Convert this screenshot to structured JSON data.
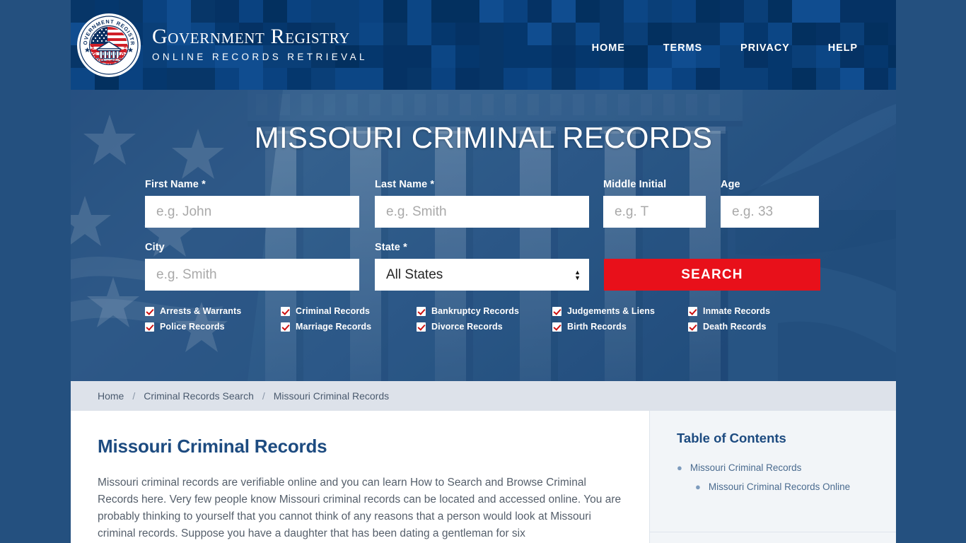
{
  "header": {
    "brand_title": "Government Registry",
    "brand_subtitle": "ONLINE RECORDS RETRIEVAL",
    "logo": {
      "top_text": "GOVERNMENT REGISTRY",
      "bottom_text": "PUBLIC RECORDS"
    },
    "nav": [
      {
        "label": "HOME"
      },
      {
        "label": "TERMS"
      },
      {
        "label": "PRIVACY"
      },
      {
        "label": "HELP"
      }
    ]
  },
  "hero": {
    "title": "MISSOURI CRIMINAL RECORDS",
    "form": {
      "first_name": {
        "label": "First Name *",
        "placeholder": "e.g. John",
        "value": ""
      },
      "last_name": {
        "label": "Last Name *",
        "placeholder": "e.g. Smith",
        "value": ""
      },
      "middle_initial": {
        "label": "Middle Initial",
        "placeholder": "e.g. T",
        "value": ""
      },
      "age": {
        "label": "Age",
        "placeholder": "e.g. 33",
        "value": ""
      },
      "city": {
        "label": "City",
        "placeholder": "e.g. Smith",
        "value": ""
      },
      "state": {
        "label": "State *",
        "selected": "All States"
      },
      "search_button": "SEARCH"
    },
    "record_types": [
      "Arrests & Warrants",
      "Criminal Records",
      "Bankruptcy Records",
      "Judgements & Liens",
      "Inmate Records",
      "Police Records",
      "Marriage Records",
      "Divorce Records",
      "Birth Records",
      "Death Records"
    ]
  },
  "breadcrumb": [
    {
      "label": "Home"
    },
    {
      "label": "Criminal Records Search"
    },
    {
      "label": "Missouri Criminal Records"
    }
  ],
  "breadcrumb_separator": "/",
  "article": {
    "heading": "Missouri Criminal Records",
    "paragraph": "Missouri criminal records are verifiable online and you can learn How to Search and Browse Criminal Records here. Very few people know Missouri criminal records can be located and accessed online. You are probably thinking to yourself that you cannot think of any reasons that a person would look at Missouri criminal records. Suppose you have a daughter that has been dating a gentleman for six"
  },
  "toc": {
    "heading": "Table of Contents",
    "items": [
      {
        "label": "Missouri Criminal Records",
        "level": 1
      },
      {
        "label": "Missouri Criminal Records Online",
        "level": 2
      }
    ]
  },
  "colors": {
    "header_blue": "#043a72",
    "hero_blue": "#335f90",
    "accent_red": "#e8101a",
    "body_blue": "#24507f",
    "heading_blue": "#1d4b80",
    "breadcrumb_bg": "#dde2ea",
    "sidebar_bg": "#f2f5f8"
  }
}
